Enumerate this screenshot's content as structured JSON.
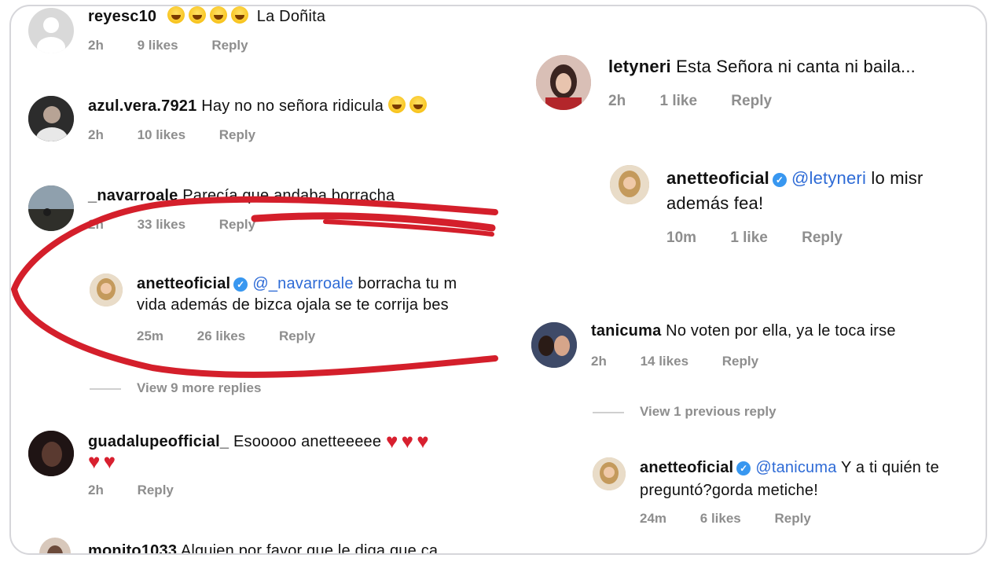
{
  "left_comments": [
    {
      "username": "reyesc10",
      "text": "La Doñita",
      "emoji": "laugh-emoji",
      "emoji_count": 4,
      "time": "2h",
      "likes": "9 likes",
      "reply": "Reply"
    },
    {
      "username": "azul.vera.7921",
      "text": "Hay no no señora ridicula",
      "emoji": "laugh-emoji",
      "emoji_count": 2,
      "time": "2h",
      "likes": "10 likes",
      "reply": "Reply"
    },
    {
      "username": "_navarroale",
      "text": "Parecía que andaba borracha",
      "time": "2h",
      "likes": "33 likes",
      "reply": "Reply"
    },
    {
      "username": "anetteoficial",
      "mention": "@_navarroale",
      "text": "borracha tu m",
      "text_line2": "vida además de bizca ojala se te corrija bes",
      "time": "25m",
      "likes": "26 likes",
      "reply": "Reply"
    },
    {
      "username": "guadalupeofficial_",
      "text": "Esooooo anetteeeee",
      "time": "2h",
      "reply": "Reply"
    },
    {
      "username": "monito1033",
      "text": "Alguien por favor que le diga que ca"
    }
  ],
  "left_view_replies": "View 9 more replies",
  "right_comments": [
    {
      "username": "letyneri",
      "text": "Esta Señora ni canta ni baila...",
      "time": "2h",
      "likes": "1 like",
      "reply": "Reply"
    },
    {
      "username": "anetteoficial",
      "mention": "@letyneri",
      "text": "lo misr",
      "text_line2": "además fea!",
      "time": "10m",
      "likes": "1 like",
      "reply": "Reply"
    },
    {
      "username": "tanicuma",
      "text": "No voten por ella, ya le toca irse",
      "time": "2h",
      "likes": "14 likes",
      "reply": "Reply"
    },
    {
      "username": "anetteoficial",
      "mention": "@tanicuma",
      "text": "Y a ti quién te",
      "text_line2": "preguntó?gorda metiche!",
      "time": "24m",
      "likes": "6 likes",
      "reply": "Reply"
    }
  ],
  "right_view_replies": "View 1 previous reply",
  "colors": {
    "mention": "#2e6bd6",
    "verified": "#3897f0",
    "highlight": "#d41f2b",
    "heart": "#d8202f",
    "meta": "#8e8e8e"
  },
  "icons": {
    "verified": "verified-badge-icon",
    "heart": "heart-emoji",
    "laugh": "laugh-emoji",
    "highlight": "red-marker-circle"
  }
}
